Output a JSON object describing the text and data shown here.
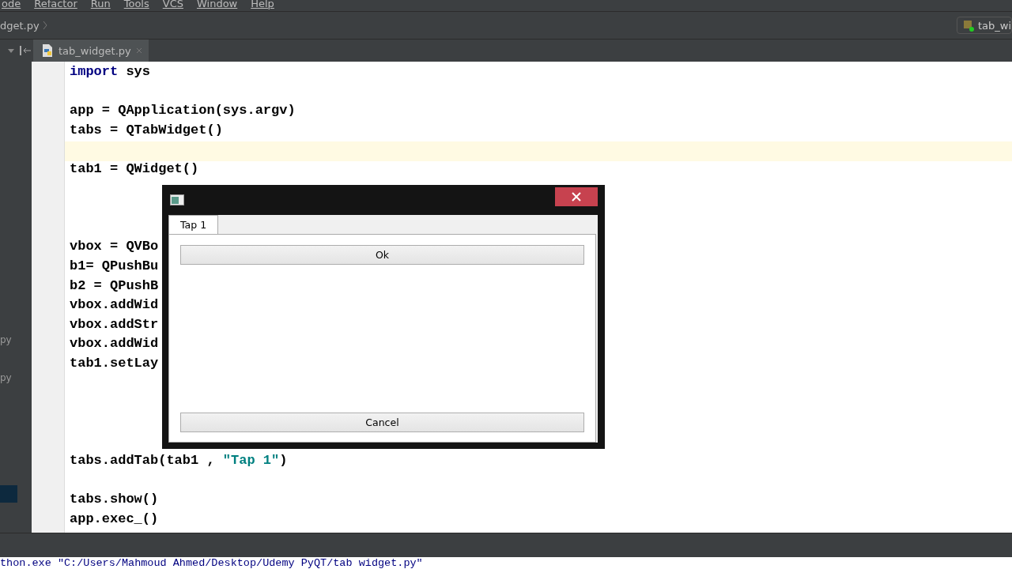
{
  "menu": [
    "ode",
    "Refactor",
    "Run",
    "Tools",
    "VCS",
    "Window",
    "Help"
  ],
  "breadcrumb": "dget.py",
  "run_config": "tab_wi",
  "editor_tabs": [
    {
      "label": "tab_widget.py",
      "selected": true
    }
  ],
  "side_labels": [
    "py",
    "py"
  ],
  "code": [
    {
      "kind": "code",
      "current": false,
      "segments": [
        {
          "kind": "keyword",
          "text": "import"
        },
        {
          "kind": "plain",
          "text": " sys"
        }
      ]
    },
    {
      "kind": "blank",
      "current": false
    },
    {
      "kind": "code",
      "current": false,
      "segments": [
        {
          "kind": "plain",
          "text": "app = QApplication(sys.argv)"
        }
      ]
    },
    {
      "kind": "code",
      "current": false,
      "segments": [
        {
          "kind": "plain",
          "text": "tabs = QTabWidget()"
        }
      ]
    },
    {
      "kind": "blank",
      "current": true
    },
    {
      "kind": "code",
      "current": false,
      "segments": [
        {
          "kind": "plain",
          "text": "tab1 = QWidget()"
        }
      ]
    },
    {
      "kind": "blank",
      "current": false
    },
    {
      "kind": "blank",
      "current": false
    },
    {
      "kind": "blank",
      "current": false
    },
    {
      "kind": "code",
      "current": false,
      "segments": [
        {
          "kind": "plain",
          "text": "vbox = QVBo"
        }
      ]
    },
    {
      "kind": "code",
      "current": false,
      "segments": [
        {
          "kind": "plain",
          "text": "b1= QPushBu"
        }
      ]
    },
    {
      "kind": "code",
      "current": false,
      "segments": [
        {
          "kind": "plain",
          "text": "b2 = QPushB"
        }
      ]
    },
    {
      "kind": "code",
      "current": false,
      "segments": [
        {
          "kind": "plain",
          "text": "vbox.addWid"
        }
      ]
    },
    {
      "kind": "code",
      "current": false,
      "segments": [
        {
          "kind": "plain",
          "text": "vbox.addStr"
        }
      ]
    },
    {
      "kind": "code",
      "current": false,
      "segments": [
        {
          "kind": "plain",
          "text": "vbox.addWid"
        }
      ]
    },
    {
      "kind": "code",
      "current": false,
      "segments": [
        {
          "kind": "plain",
          "text": "tab1.setLay"
        }
      ]
    },
    {
      "kind": "blank",
      "current": false
    },
    {
      "kind": "blank",
      "current": false
    },
    {
      "kind": "blank",
      "current": false
    },
    {
      "kind": "blank",
      "current": false
    },
    {
      "kind": "code",
      "current": false,
      "segments": [
        {
          "kind": "plain",
          "text": "tabs.addTab(tab1 , "
        },
        {
          "kind": "string",
          "text": "\"Tap 1\""
        },
        {
          "kind": "plain",
          "text": ")"
        }
      ]
    },
    {
      "kind": "blank",
      "current": false
    },
    {
      "kind": "code",
      "current": false,
      "segments": [
        {
          "kind": "plain",
          "text": "tabs.show()"
        }
      ]
    },
    {
      "kind": "code",
      "current": false,
      "segments": [
        {
          "kind": "plain",
          "text": "app.exec_()"
        }
      ]
    }
  ],
  "dialog": {
    "tabs": [
      {
        "label": "Tap 1",
        "selected": true
      }
    ],
    "buttons": [
      "Ok",
      "Cancel"
    ]
  },
  "console": "thon.exe \"C:/Users/Mahmoud Ahmed/Desktop/Udemy PyQT/tab widget.py\""
}
